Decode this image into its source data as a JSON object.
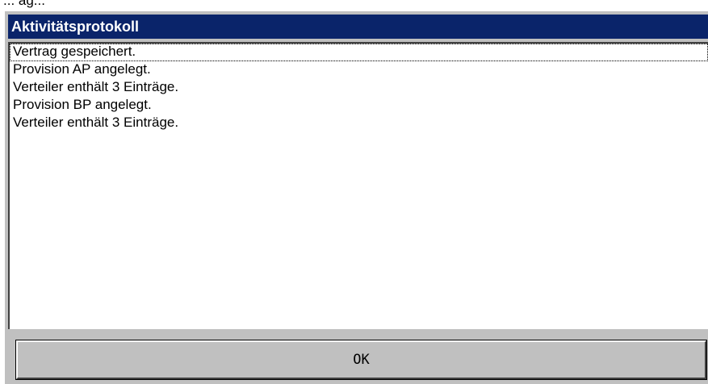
{
  "background_text": "... ag...",
  "dialog": {
    "title": "Aktivitätsprotokoll",
    "log_entries": [
      "Vertrag gespeichert.",
      "Provision AP angelegt.",
      "Verteiler enthält 3 Einträge.",
      "Provision BP angelegt.",
      "Verteiler enthält 3 Einträge."
    ],
    "ok_label": "OK"
  },
  "colors": {
    "title_bar": "#0a246a",
    "dialog_face": "#c0c0c0",
    "list_background": "#ffffff"
  }
}
